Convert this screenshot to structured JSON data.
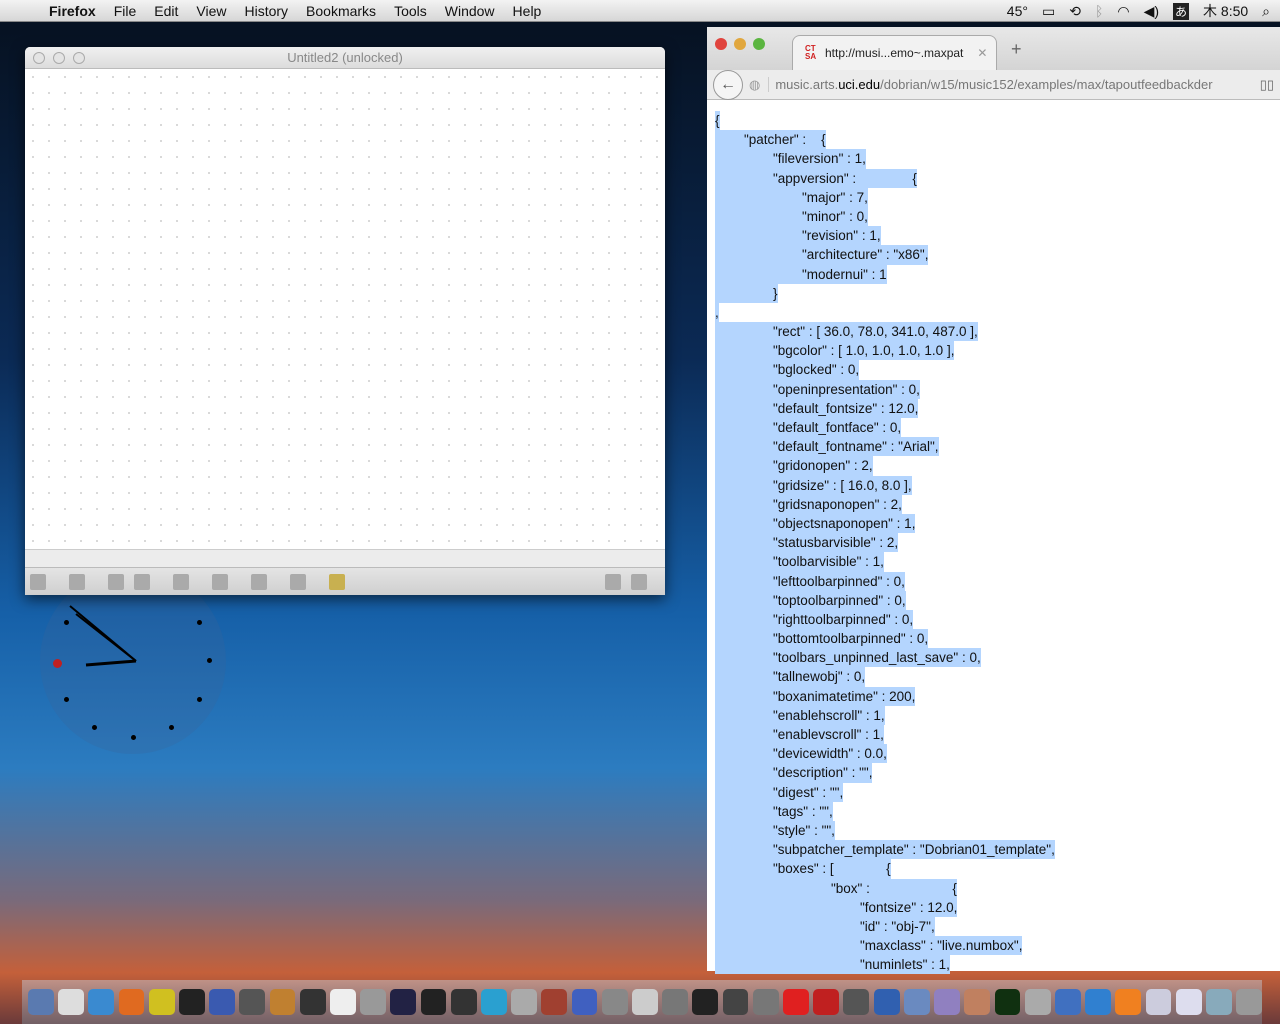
{
  "menubar": {
    "app": "Firefox",
    "items": [
      "File",
      "Edit",
      "View",
      "History",
      "Bookmarks",
      "Tools",
      "Window",
      "Help"
    ],
    "temp": "45°",
    "input_method": "あ",
    "clock": "木 8:50"
  },
  "max_window": {
    "title": "Untitled2 (unlocked)"
  },
  "browser": {
    "tab_title": "http://musi...emo~.maxpat",
    "favicon": "CT SA",
    "url_prefix": "music.arts.",
    "url_domain": "uci.edu",
    "url_path": "/dobrian/w15/music152/examples/max/tapoutfeedbackder"
  },
  "code_lines": [
    {
      "i": 0,
      "t": "{"
    },
    {
      "i": 1,
      "t": "\"patcher\" :    {"
    },
    {
      "i": 2,
      "t": "\"fileversion\" : 1,"
    },
    {
      "i": 2,
      "t": "\"appversion\" :               {"
    },
    {
      "i": 3,
      "t": "\"major\" : 7,"
    },
    {
      "i": 3,
      "t": "\"minor\" : 0,"
    },
    {
      "i": 3,
      "t": "\"revision\" : 1,"
    },
    {
      "i": 3,
      "t": "\"architecture\" : \"x86\","
    },
    {
      "i": 3,
      "t": "\"modernui\" : 1"
    },
    {
      "i": 2,
      "t": "}"
    },
    {
      "i": 0,
      "t": ","
    },
    {
      "i": 2,
      "t": "\"rect\" : [ 36.0, 78.0, 341.0, 487.0 ],"
    },
    {
      "i": 2,
      "t": "\"bgcolor\" : [ 1.0, 1.0, 1.0, 1.0 ],"
    },
    {
      "i": 2,
      "t": "\"bglocked\" : 0,"
    },
    {
      "i": 2,
      "t": "\"openinpresentation\" : 0,"
    },
    {
      "i": 2,
      "t": "\"default_fontsize\" : 12.0,"
    },
    {
      "i": 2,
      "t": "\"default_fontface\" : 0,"
    },
    {
      "i": 2,
      "t": "\"default_fontname\" : \"Arial\","
    },
    {
      "i": 2,
      "t": "\"gridonopen\" : 2,"
    },
    {
      "i": 2,
      "t": "\"gridsize\" : [ 16.0, 8.0 ],"
    },
    {
      "i": 2,
      "t": "\"gridsnaponopen\" : 2,"
    },
    {
      "i": 2,
      "t": "\"objectsnaponopen\" : 1,"
    },
    {
      "i": 2,
      "t": "\"statusbarvisible\" : 2,"
    },
    {
      "i": 2,
      "t": "\"toolbarvisible\" : 1,"
    },
    {
      "i": 2,
      "t": "\"lefttoolbarpinned\" : 0,"
    },
    {
      "i": 2,
      "t": "\"toptoolbarpinned\" : 0,"
    },
    {
      "i": 2,
      "t": "\"righttoolbarpinned\" : 0,"
    },
    {
      "i": 2,
      "t": "\"bottomtoolbarpinned\" : 0,"
    },
    {
      "i": 2,
      "t": "\"toolbars_unpinned_last_save\" : 0,"
    },
    {
      "i": 2,
      "t": "\"tallnewobj\" : 0,"
    },
    {
      "i": 2,
      "t": "\"boxanimatetime\" : 200,"
    },
    {
      "i": 2,
      "t": "\"enablehscroll\" : 1,"
    },
    {
      "i": 2,
      "t": "\"enablevscroll\" : 1,"
    },
    {
      "i": 2,
      "t": "\"devicewidth\" : 0.0,"
    },
    {
      "i": 2,
      "t": "\"description\" : \"\","
    },
    {
      "i": 2,
      "t": "\"digest\" : \"\","
    },
    {
      "i": 2,
      "t": "\"tags\" : \"\","
    },
    {
      "i": 2,
      "t": "\"style\" : \"\","
    },
    {
      "i": 2,
      "t": "\"subpatcher_template\" : \"Dobrian01_template\","
    },
    {
      "i": 2,
      "t": "\"boxes\" : [              {"
    },
    {
      "i": 4,
      "t": "\"box\" :                      {"
    },
    {
      "i": 5,
      "t": "\"fontsize\" : 12.0,"
    },
    {
      "i": 5,
      "t": "\"id\" : \"obj-7\","
    },
    {
      "i": 5,
      "t": "\"maxclass\" : \"live.numbox\","
    },
    {
      "i": 5,
      "t": "\"numinlets\" : 1,"
    }
  ],
  "dock_colors": [
    "#5a7ab0",
    "#ddd",
    "#3a8ad0",
    "#e06a20",
    "#d0c020",
    "#222",
    "#3a5ab0",
    "#555",
    "#c08030",
    "#333",
    "#eee",
    "#999",
    "#224",
    "#222",
    "#333",
    "#2aa0d0",
    "#aaa",
    "#a04030",
    "#4060c0",
    "#888",
    "#ccc",
    "#777",
    "#222",
    "#444",
    "#777",
    "#e02020",
    "#c02020",
    "#555",
    "#3060b0",
    "#6a8ac0",
    "#9080c0",
    "#c08060",
    "#103010",
    "#aaa",
    "#4070c0",
    "#3080d0",
    "#f08020",
    "#ccd",
    "#dde",
    "#8ab",
    "#999"
  ]
}
